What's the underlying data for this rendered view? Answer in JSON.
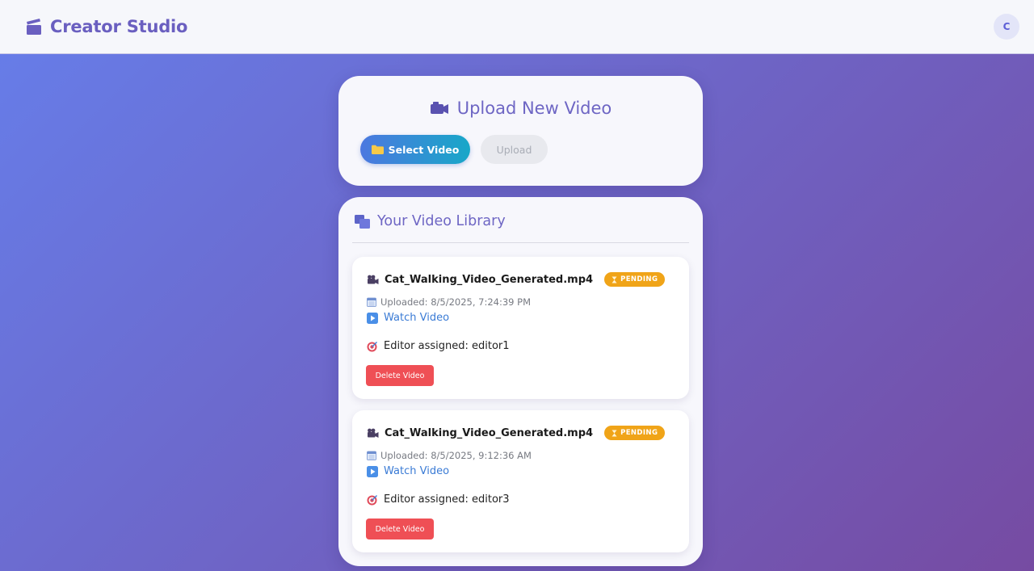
{
  "app": {
    "title": "Creator Studio",
    "brand_icon": "clapperboard-icon",
    "avatar_initial": "C"
  },
  "upload": {
    "title": "Upload New Video",
    "title_icon": "camera-icon",
    "select_button": "Select Video",
    "select_icon": "folder-icon",
    "upload_button": "Upload"
  },
  "library": {
    "title": "Your Video Library",
    "title_icon": "stacked-files-icon",
    "videos": [
      {
        "name": "Cat_Walking_Video_Generated.mp4",
        "status": "PENDING",
        "uploaded": "Uploaded: 8/5/2025, 7:24:39 PM",
        "watch_label": "Watch Video",
        "editor": "Editor assigned: editor1",
        "delete_label": "Delete Video"
      },
      {
        "name": "Cat_Walking_Video_Generated.mp4",
        "status": "PENDING",
        "uploaded": "Uploaded: 8/5/2025, 9:12:36 AM",
        "watch_label": "Watch Video",
        "editor": "Editor assigned: editor3",
        "delete_label": "Delete Video"
      }
    ]
  },
  "colors": {
    "background_gradient": [
      "#667eea",
      "#764ba2"
    ],
    "brand": "#6a5fc0",
    "badge_pending": "#f0a418",
    "delete": "#ef4f55",
    "link": "#3a7bd5"
  }
}
